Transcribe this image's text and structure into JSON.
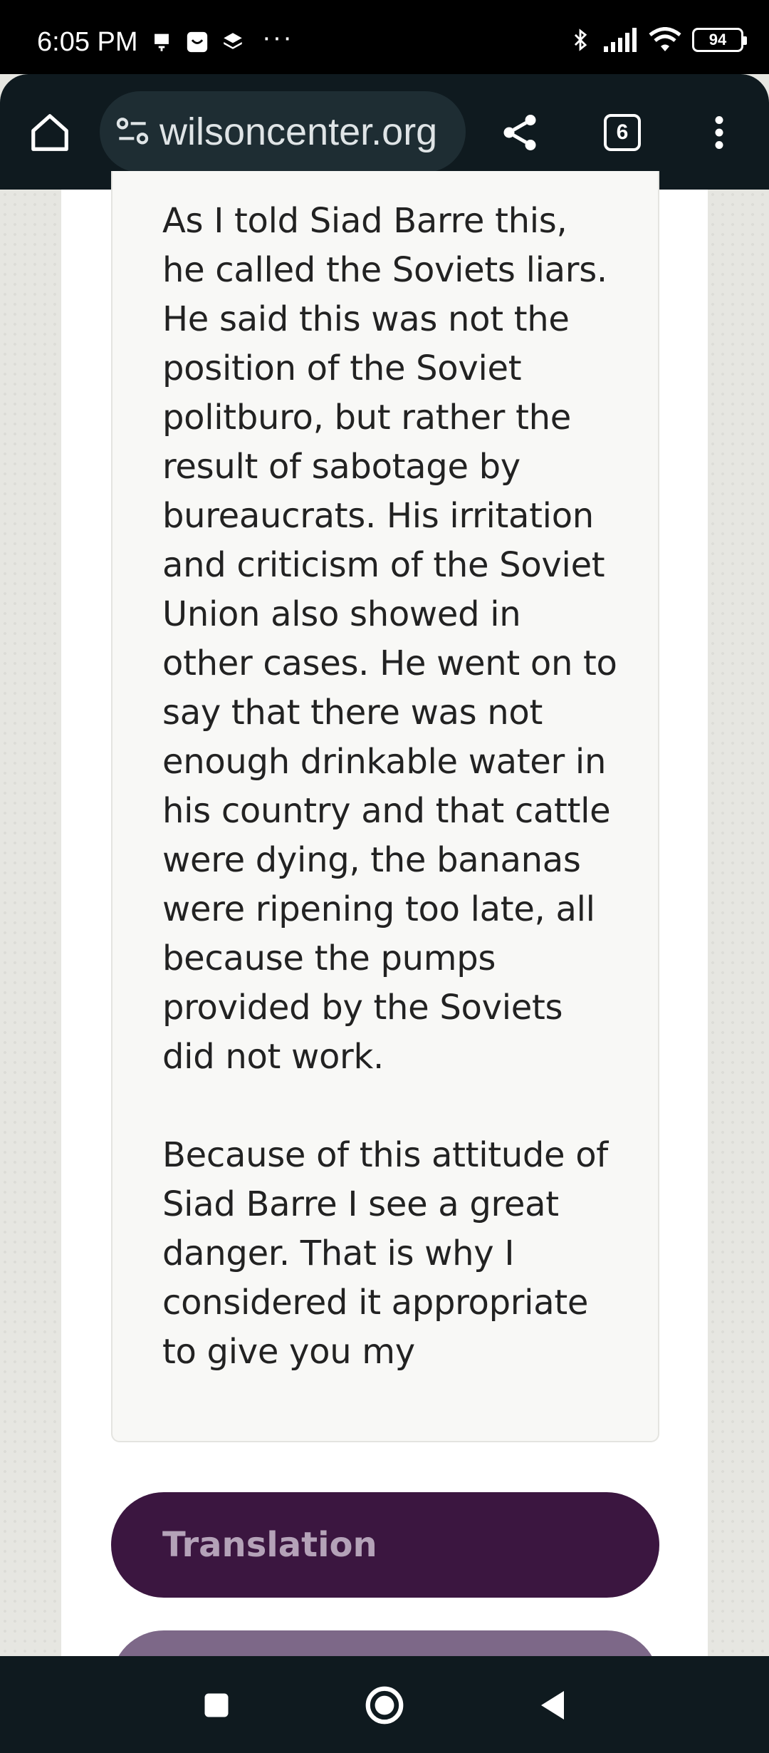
{
  "status_bar": {
    "time": "6:05 PM",
    "dots": "···",
    "battery": "94",
    "icons": [
      "notification-icon",
      "messenger-icon",
      "layers-icon",
      "bluetooth-icon",
      "signal-icon",
      "wifi-icon",
      "battery-icon"
    ]
  },
  "browser": {
    "url": "wilsoncenter.org",
    "tab_count": "6",
    "icons": [
      "home-icon",
      "site-settings-icon",
      "share-icon",
      "tabs-icon",
      "more-vert-icon"
    ]
  },
  "article": {
    "paragraph_1": "As I told Siad Barre this, he called the Soviets liars. He said this was not the position of the Soviet politburo, but rather the result of sabotage by bureaucrats. His irritation and criticism of the Soviet Union also showed in other cases. He went on to say that there was not enough drinkable water in his country and that cattle were dying, the bananas were ripening too late, all because the pumps provided by the Soviets did not work.",
    "paragraph_2": "Because of this attitude of Siad Barre I see a great danger. That is why I considered it appropriate to give you my"
  },
  "buttons": {
    "translation": "Translation"
  },
  "colors": {
    "translation_button": "#3b1640",
    "secondary_button": "#7d6888",
    "toolbar": "#0f1a1f"
  },
  "nav": {
    "icons": [
      "recents-icon",
      "home-circle-icon",
      "back-icon"
    ]
  }
}
